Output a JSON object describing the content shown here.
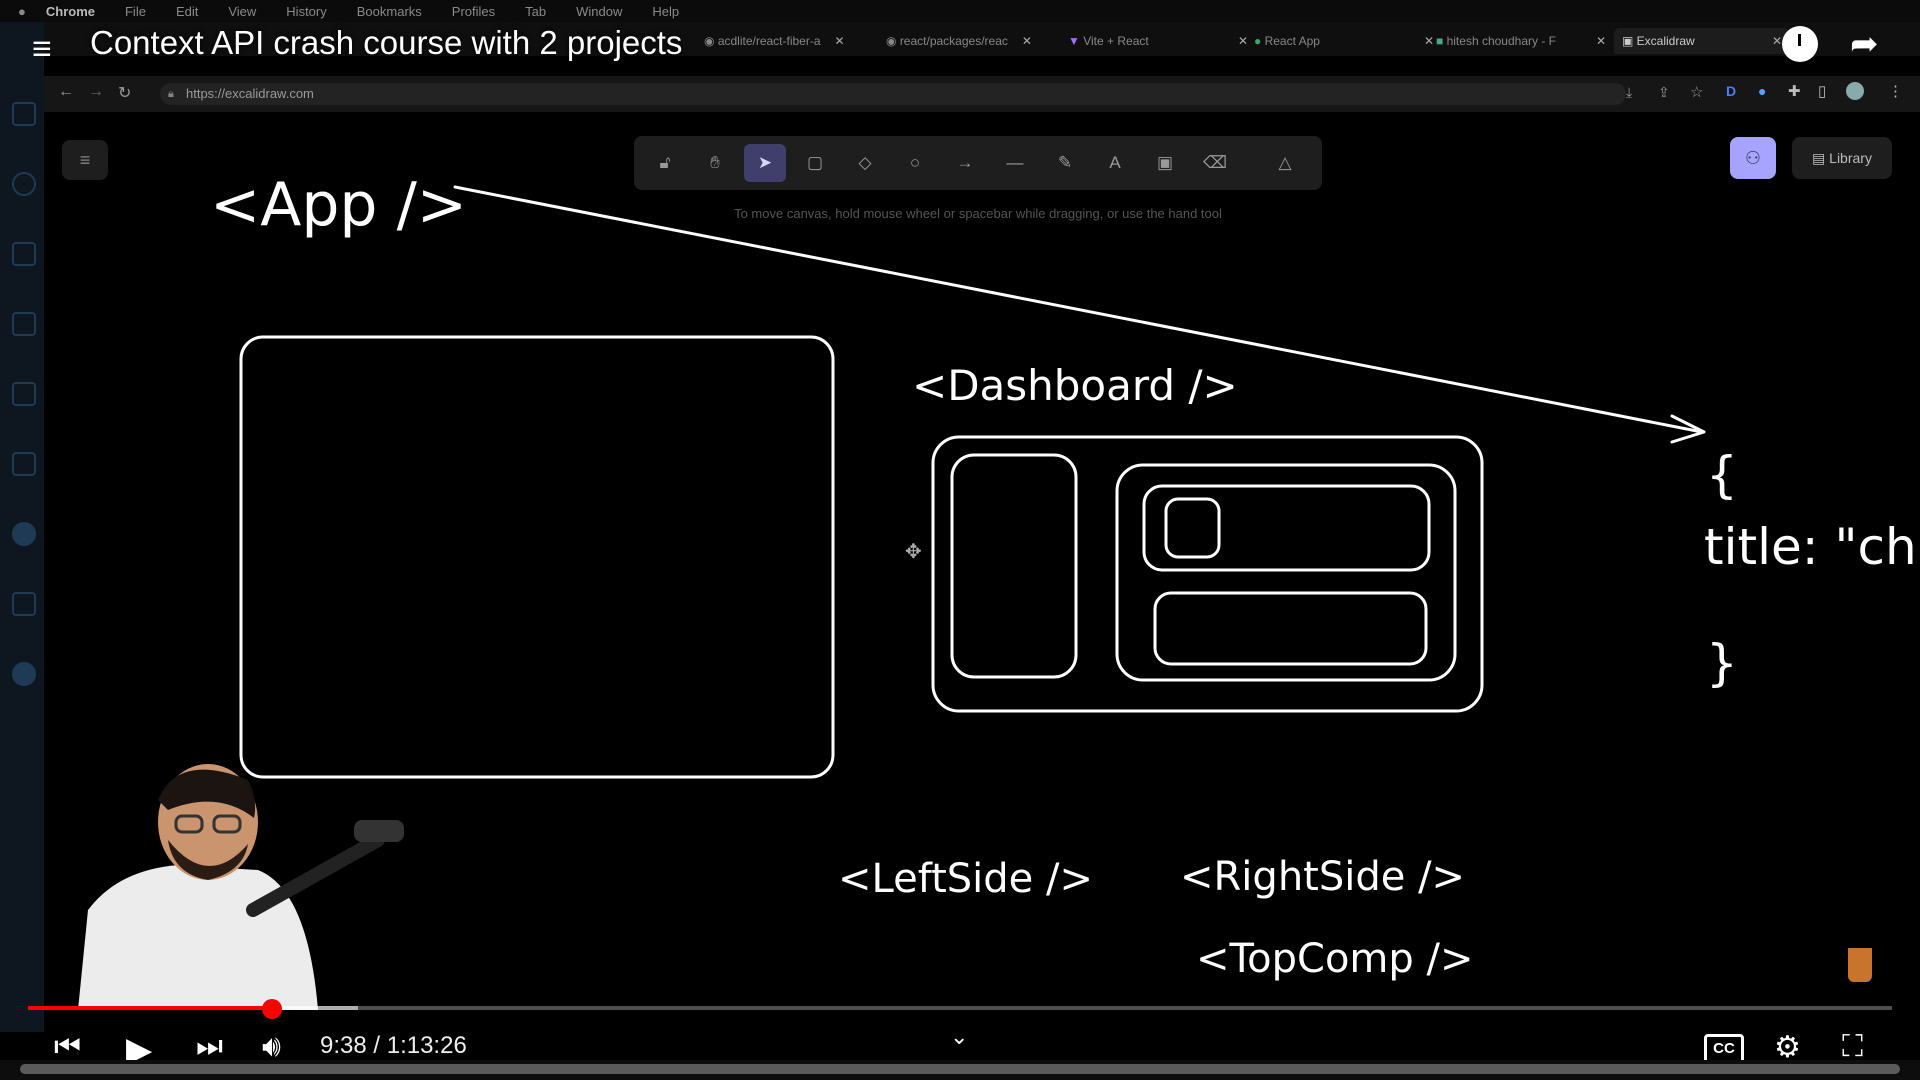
{
  "mac_menu": [
    "Chrome",
    "File",
    "Edit",
    "View",
    "History",
    "Bookmarks",
    "Profiles",
    "Tab",
    "Window",
    "Help"
  ],
  "video_title": "Context API crash course with 2 projects",
  "tabs": [
    {
      "label": "acdlite/react-fiber-a"
    },
    {
      "label": "react/packages/reac"
    },
    {
      "label": "Vite + React"
    },
    {
      "label": "React App"
    },
    {
      "label": "hitesh choudhary - F"
    },
    {
      "label": "Excalidraw",
      "active": true
    }
  ],
  "address": "https://excalidraw.com",
  "toolbar": {
    "tools": [
      {
        "name": "lock",
        "icon": "lock-icon",
        "glyph": "🔓︎"
      },
      {
        "name": "hand",
        "icon": "hand-icon",
        "glyph": "✋︎"
      },
      {
        "name": "selection",
        "icon": "cursor-icon",
        "glyph": "➤",
        "active": true
      },
      {
        "name": "rectangle",
        "icon": "rectangle-icon",
        "glyph": "▢"
      },
      {
        "name": "diamond",
        "icon": "diamond-icon",
        "glyph": "◇"
      },
      {
        "name": "ellipse",
        "icon": "ellipse-icon",
        "glyph": "○"
      },
      {
        "name": "arrow",
        "icon": "arrow-icon",
        "glyph": "→"
      },
      {
        "name": "line",
        "icon": "line-icon",
        "glyph": "—"
      },
      {
        "name": "draw",
        "icon": "pencil-icon",
        "glyph": "✎"
      },
      {
        "name": "text",
        "icon": "text-icon",
        "glyph": "A"
      },
      {
        "name": "image",
        "icon": "image-icon",
        "glyph": "▣"
      },
      {
        "name": "eraser",
        "icon": "eraser-icon",
        "glyph": "⌫"
      },
      {
        "name": "extra",
        "icon": "shapes-icon",
        "glyph": "△"
      }
    ],
    "hint": "To move canvas, hold mouse wheel or spacebar while dragging, or use the hand tool"
  },
  "library_label": "Library",
  "canvas_text": {
    "app": "<App />",
    "dashboard": "<Dashboard />",
    "leftside": "<LeftSide />",
    "rightside": "<RightSide />",
    "topcomp": "<TopComp />",
    "brace_open": "{",
    "title_text": "title: \"ch",
    "brace_close": "}"
  },
  "player": {
    "time_current": "9:38",
    "time_total": "1:13:26",
    "time_display": "9:38 / 1:13:26",
    "progress_fraction": 0.131,
    "cc_label": "CC"
  }
}
